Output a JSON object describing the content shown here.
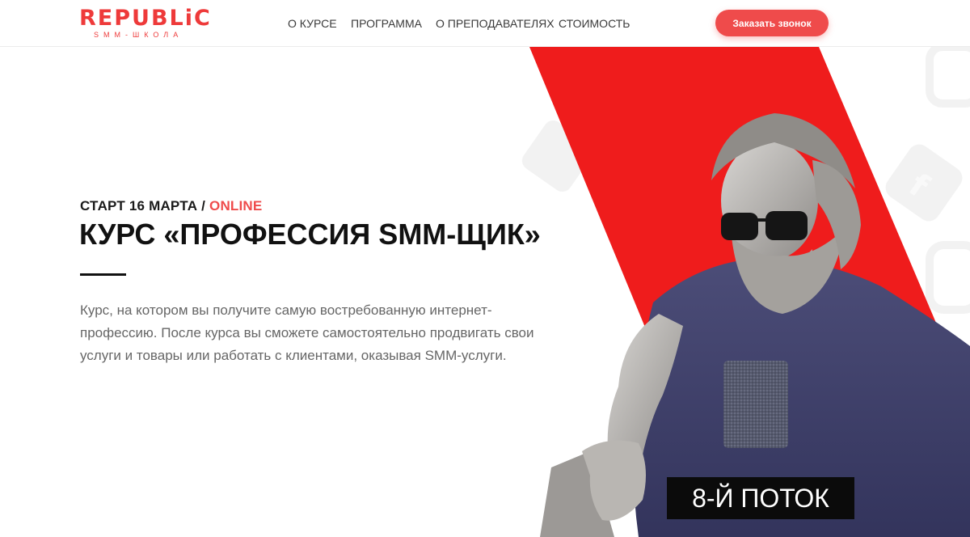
{
  "header": {
    "logo": {
      "main": "REPUBLiC",
      "sub": "SMM-ШКОЛА"
    },
    "nav": [
      {
        "label": "О КУРСЕ"
      },
      {
        "label": "ПРОГРАММА"
      },
      {
        "label": "О ПРЕПОДАВАТЕЛЯХ"
      },
      {
        "label": "СТОИМОСТЬ"
      }
    ],
    "cta_label": "Заказать звонок"
  },
  "hero": {
    "start_prefix": "СТАРТ 16 МАРТА / ",
    "start_mode": "ONLINE",
    "title": "КУРС «ПРОФЕССИЯ SMM-ЩИК»",
    "description_lines": [
      "Курс, на котором вы получите самую востребованную интернет-",
      "профессию. После курса вы сможете самостоятельно продвигать свои",
      "услуги и товары или работать с клиентами, оказывая SMM-услуги."
    ],
    "badge": "8-Й ПОТОК"
  },
  "colors": {
    "accent": "#ef4b4b",
    "brand": "#ee3a3a",
    "text": "#111111",
    "muted": "#666666"
  },
  "icons": [
    "facebook-icon",
    "instagram-icon"
  ]
}
